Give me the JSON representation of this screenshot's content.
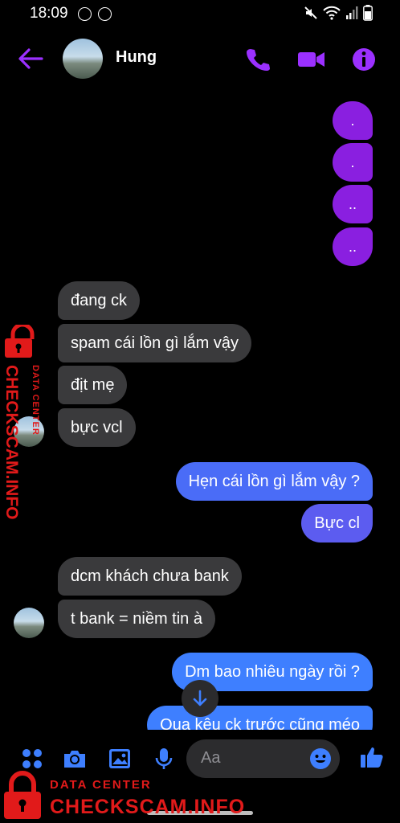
{
  "status_bar": {
    "time": "18:09",
    "left_icons": [
      "messenger-icon",
      "messenger-icon"
    ],
    "right_icons": [
      "mute-icon",
      "wifi-icon",
      "signal-icon",
      "battery-icon"
    ]
  },
  "header": {
    "contact_name": "Hung",
    "accent_color": "#9b30ff",
    "icons": [
      "back-arrow-icon",
      "phone-icon",
      "video-icon",
      "info-icon"
    ]
  },
  "messages": [
    {
      "side": "out",
      "text": "."
    },
    {
      "side": "out",
      "text": "."
    },
    {
      "side": "out",
      "text": ".."
    },
    {
      "side": "out",
      "text": ".."
    },
    {
      "side": "in",
      "text": "đang ck"
    },
    {
      "side": "in",
      "text": "spam cái lồn gì lắm vậy"
    },
    {
      "side": "in",
      "text": "địt mẹ"
    },
    {
      "side": "in",
      "text": "bực vcl"
    },
    {
      "side": "out",
      "text": "Hẹn cái lồn gì lắm vậy ?"
    },
    {
      "side": "out",
      "text": "Bực cl"
    },
    {
      "side": "in",
      "text": "dcm khách chưa bank"
    },
    {
      "side": "in",
      "text": "t bank = niềm tin à"
    },
    {
      "side": "out",
      "text": "Dm bao nhiêu ngày rồi ?"
    },
    {
      "side": "out",
      "text": "Qua kêu ck trước cũng méo"
    }
  ],
  "colors": {
    "incoming_bubble": "#3a3a3c",
    "outgoing_purple": "#8a1fe0",
    "outgoing_blue": "#3e7fff",
    "outgoing_indigo": "#5c5cf0"
  },
  "composer": {
    "placeholder": "Aa",
    "icons": [
      "apps-icon",
      "camera-icon",
      "image-icon",
      "microphone-icon",
      "emoji-icon",
      "thumbs-up-icon"
    ]
  },
  "watermark": {
    "small_text": "DATA CENTER",
    "big_text": "CHECKSCAM.INFO"
  }
}
